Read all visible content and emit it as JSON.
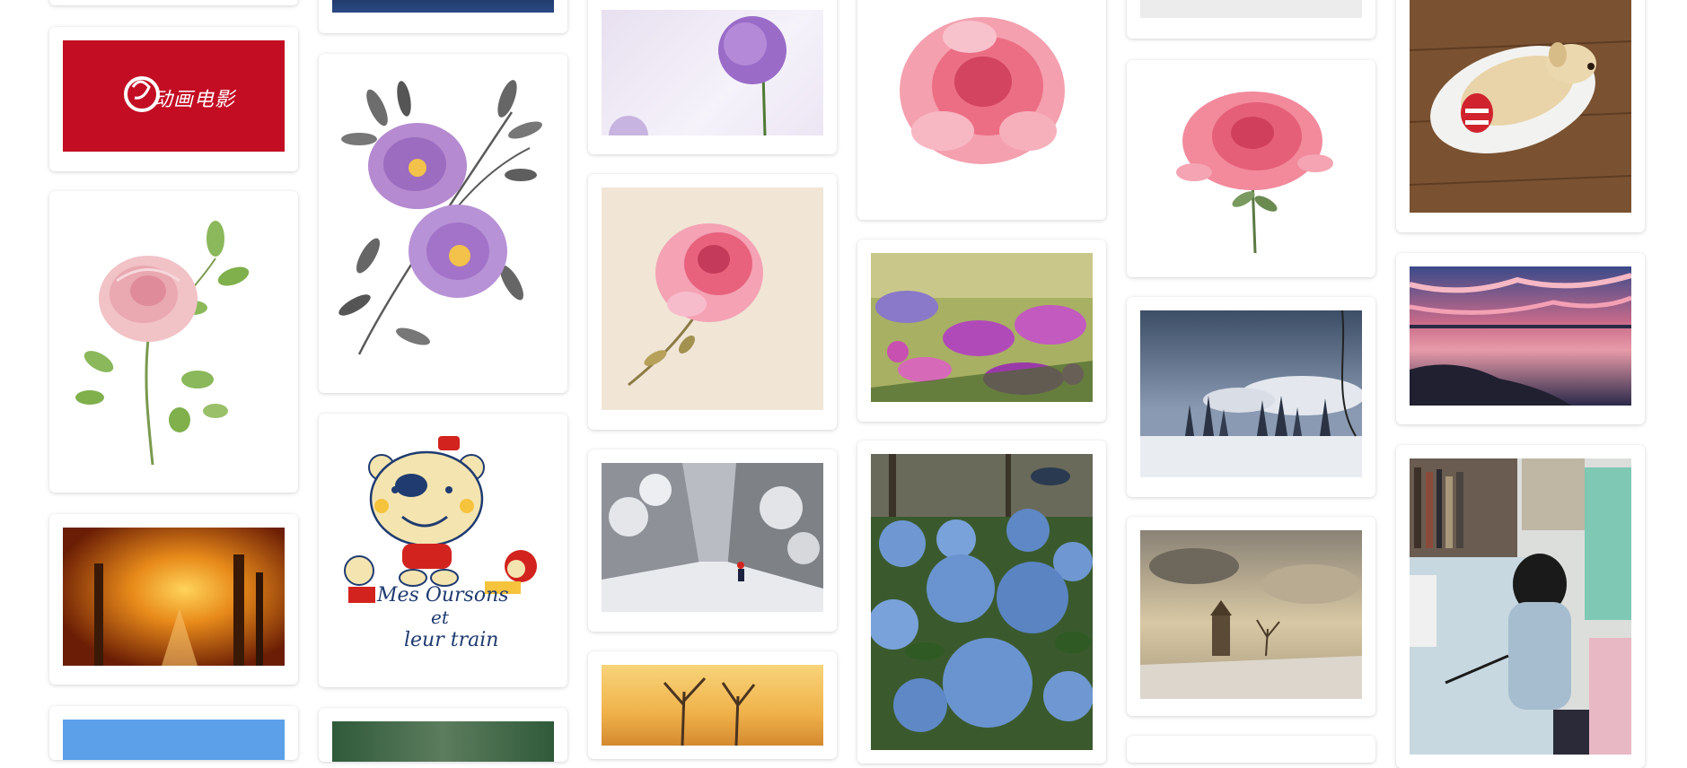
{
  "gallery": {
    "items": [
      {
        "id": "movie-logo",
        "label": "动画电影",
        "bg": "#c30d23"
      },
      {
        "id": "watercolor-pink-rose"
      },
      {
        "id": "autumn-forest-path"
      },
      {
        "id": "purple-peony-branch"
      },
      {
        "id": "bear-cartoon",
        "title_line1": "Mes Oursons",
        "title_line2": "et",
        "title_line3": "leur train"
      },
      {
        "id": "purple-allium"
      },
      {
        "id": "watercolor-peony"
      },
      {
        "id": "snowy-forest-road"
      },
      {
        "id": "sunset-bare-trees"
      },
      {
        "id": "pink-peony"
      },
      {
        "id": "hydrangea-field"
      },
      {
        "id": "blue-hydrangeas"
      },
      {
        "id": "pink-rose-watercolor"
      },
      {
        "id": "winter-trees-landscape"
      },
      {
        "id": "winter-castle-painting"
      },
      {
        "id": "sleeping-puppy"
      },
      {
        "id": "sunset-lake"
      },
      {
        "id": "girl-at-desk"
      }
    ]
  }
}
